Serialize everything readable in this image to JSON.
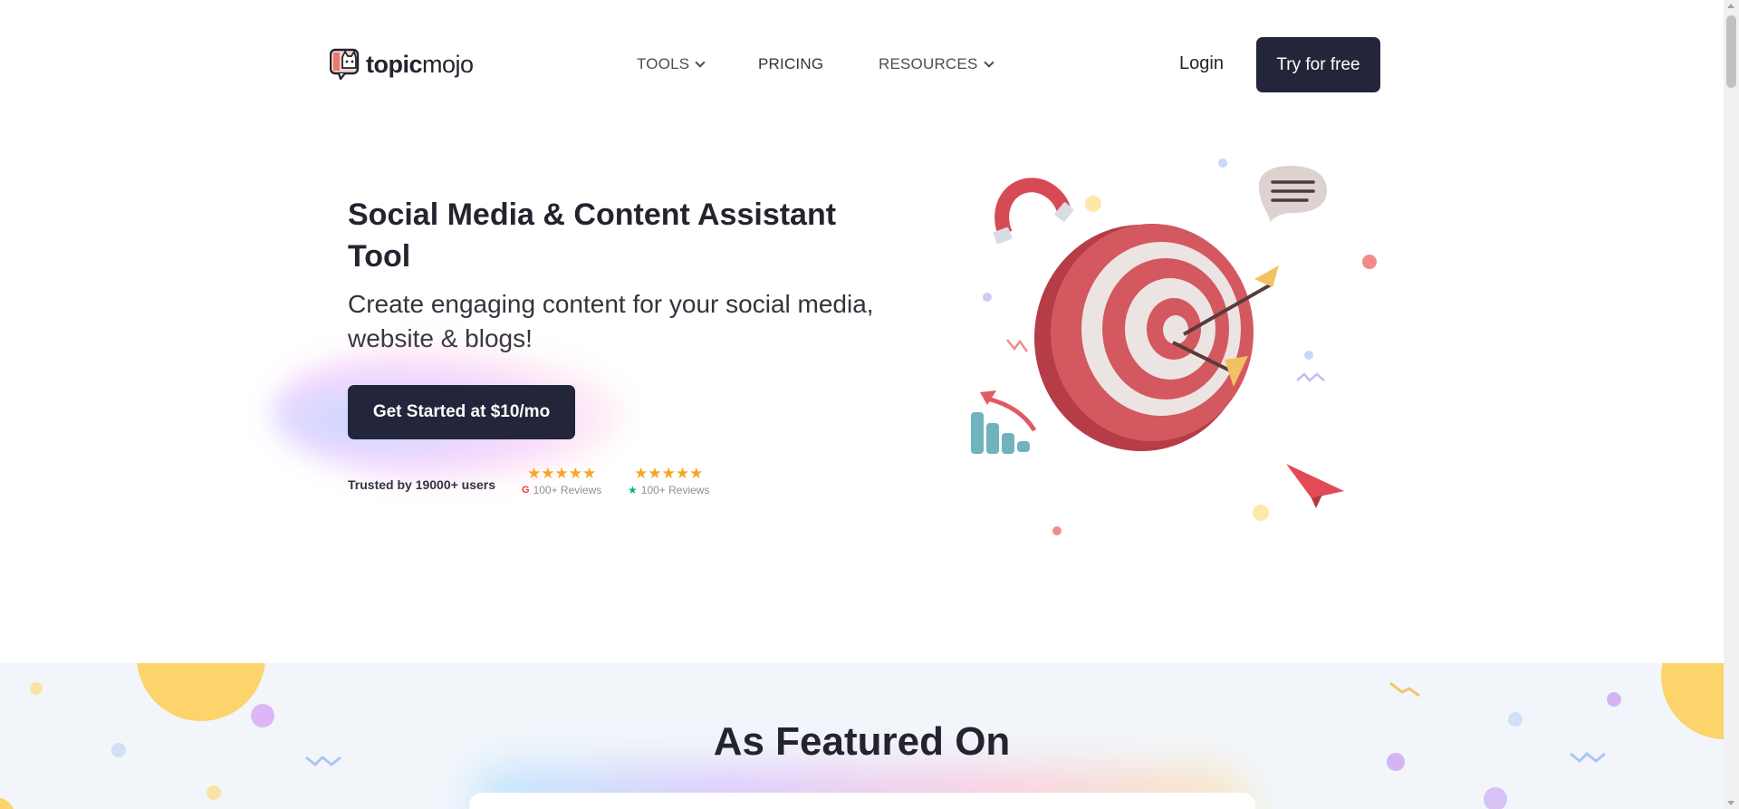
{
  "brand": {
    "logo_bold": "topic",
    "logo_light": "mojo"
  },
  "nav": {
    "tools": "TOOLS",
    "pricing": "PRICING",
    "resources": "RESOURCES",
    "login": "Login",
    "try_free": "Try for free"
  },
  "hero": {
    "title": "Social Media & Content Assistant Tool",
    "subtitle": "Create engaging content for your social media, website & blogs!",
    "cta": "Get Started at $10/mo",
    "trusted": "Trusted by 19000+ users",
    "ratings": [
      {
        "stars": "★★★★★",
        "reviews": "100+ Reviews",
        "source_icon": "google-g-icon"
      },
      {
        "stars": "★★★★★",
        "reviews": "100+ Reviews",
        "source_icon": "trustpilot-star-icon"
      }
    ]
  },
  "featured": {
    "title": "As Featured On"
  },
  "colors": {
    "dark_button": "#23263a",
    "star": "#f5a623",
    "featured_bg": "#f2f6fb",
    "target_red": "#c9494f",
    "yellow_accent": "#fdd36b",
    "purple_accent": "#c9a9f5"
  }
}
